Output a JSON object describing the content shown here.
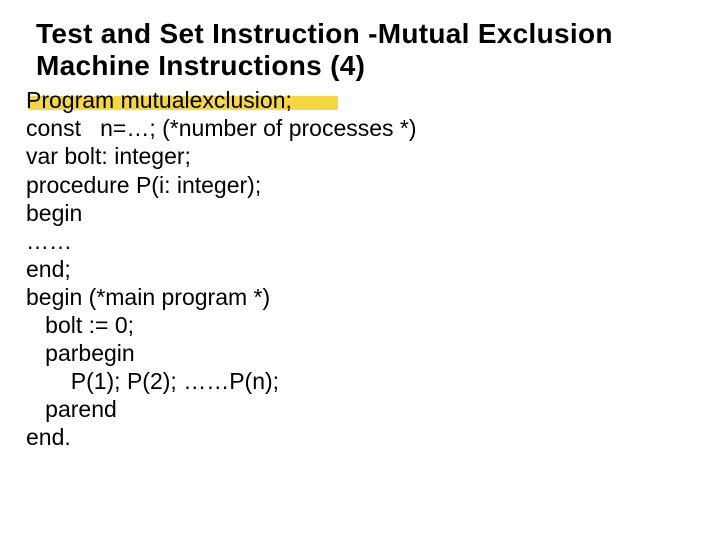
{
  "title": "Test and Set Instruction -Mutual Exclusion Machine Instructions (4)",
  "code": {
    "l1": "Program mutualexclusion;",
    "l2": "const   n=…; (*number of processes *)",
    "l3": "var bolt: integer;",
    "l4": "procedure P(i: integer);",
    "l5": "begin",
    "l6": "……",
    "l7": "end;",
    "l8": "begin (*main program *)",
    "l9": "   bolt := 0;",
    "l10": "   parbegin",
    "l11": "       P(1); P(2); ……P(n);",
    "l12": "   parend",
    "l13": "end."
  }
}
